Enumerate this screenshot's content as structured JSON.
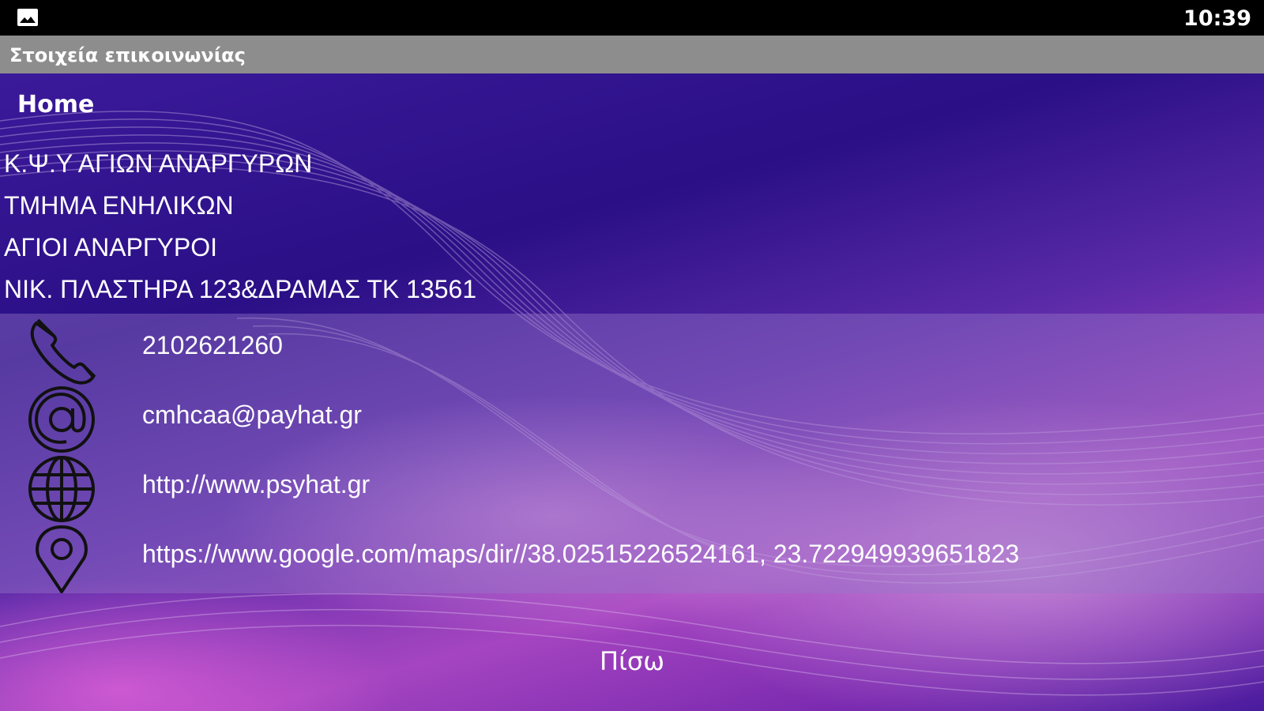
{
  "status_bar": {
    "time": "10:39",
    "notification_icon": "gallery-icon"
  },
  "title_bar": {
    "title": "Στοιχεία επικοινωνίας"
  },
  "nav": {
    "home_label": "Home"
  },
  "address": {
    "lines": [
      "Κ.Ψ.Υ ΑΓΙΩΝ ΑΝΑΡΓΥΡΩΝ",
      "ΤΜΗΜΑ ΕΝΗΛΙΚΩΝ",
      "ΑΓΙΟΙ ΑΝΑΡΓΥΡΟΙ",
      "ΝΙΚ. ΠΛΑΣΤΗΡΑ 123&ΔΡΑΜΑΣ  ΤΚ 13561"
    ]
  },
  "contacts": [
    {
      "icon": "phone-icon",
      "value": "2102621260"
    },
    {
      "icon": "email-at-icon",
      "value": "cmhcaa@payhat.gr"
    },
    {
      "icon": "globe-icon",
      "value": "http://www.psyhat.gr"
    },
    {
      "icon": "map-pin-icon",
      "value": "https://www.google.com/maps/dir//38.02515226524161, 23.722949939651823"
    }
  ],
  "footer": {
    "back_label": "Πίσω"
  },
  "colors": {
    "status_bar": "#000000",
    "title_bar": "#8d8d8d",
    "background_primary": "#2a0f86",
    "background_accent": "#a545c0",
    "panel_overlay": "#9678c8",
    "text": "#ffffff"
  }
}
